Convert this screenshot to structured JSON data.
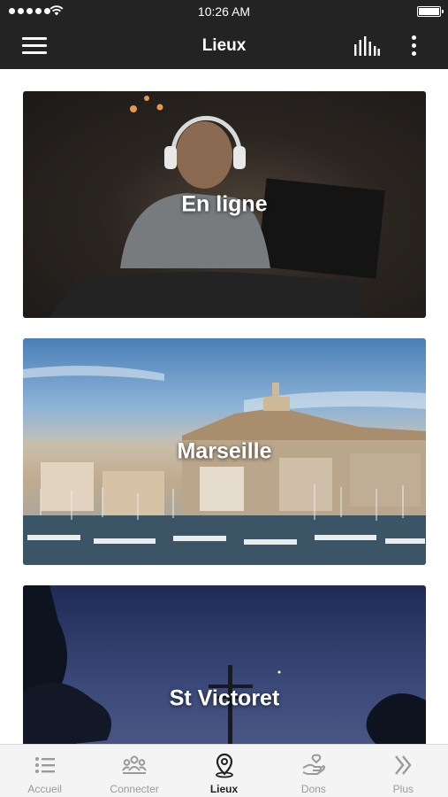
{
  "status_bar": {
    "time": "10:26 AM"
  },
  "nav": {
    "title": "Lieux"
  },
  "cards": [
    {
      "label": "En ligne"
    },
    {
      "label": "Marseille"
    },
    {
      "label": "St Victoret"
    }
  ],
  "tabs": [
    {
      "label": "Accueil",
      "icon": "list-icon",
      "active": false
    },
    {
      "label": "Connecter",
      "icon": "group-icon",
      "active": false
    },
    {
      "label": "Lieux",
      "icon": "location-pin-icon",
      "active": true
    },
    {
      "label": "Dons",
      "icon": "donate-hand-icon",
      "active": false
    },
    {
      "label": "Plus",
      "icon": "double-chevron-right-icon",
      "active": false
    }
  ],
  "colors": {
    "bar": "#232323",
    "tab_inactive": "#9a9a9a",
    "tab_active": "#222222"
  }
}
